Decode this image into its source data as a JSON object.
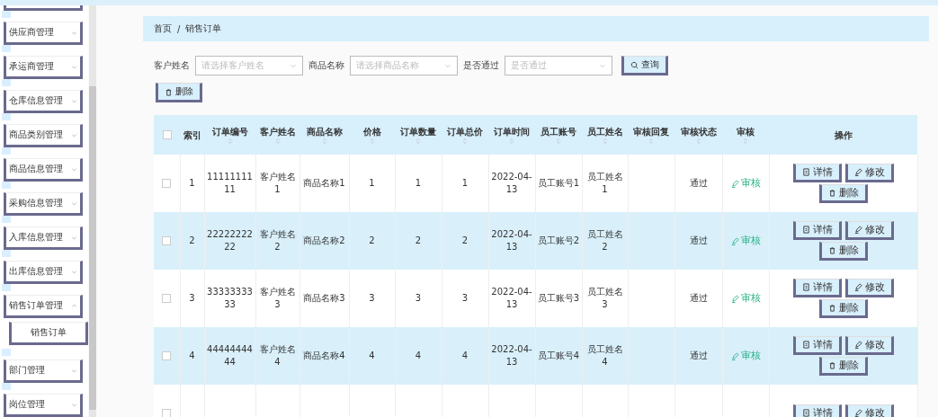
{
  "sidebar": {
    "items": [
      {
        "kind": "stub"
      },
      {
        "label": "供应商管理",
        "kind": "group",
        "expanded": false
      },
      {
        "label": "承运商管理",
        "kind": "group",
        "expanded": false
      },
      {
        "label": "仓库信息管理",
        "kind": "group",
        "expanded": false
      },
      {
        "label": "商品类别管理",
        "kind": "group",
        "expanded": false
      },
      {
        "label": "商品信息管理",
        "kind": "group",
        "expanded": false
      },
      {
        "label": "采购信息管理",
        "kind": "group",
        "expanded": false
      },
      {
        "label": "入库信息管理",
        "kind": "group",
        "expanded": false
      },
      {
        "label": "出库信息管理",
        "kind": "group",
        "expanded": false
      },
      {
        "label": "销售订单管理",
        "kind": "group",
        "expanded": true,
        "children": [
          {
            "label": "销售订单",
            "kind": "leaf"
          }
        ]
      },
      {
        "label": "部门管理",
        "kind": "group",
        "expanded": false
      },
      {
        "label": "岗位管理",
        "kind": "group",
        "expanded": false
      }
    ]
  },
  "breadcrumb": [
    "首页",
    "/",
    "销售订单"
  ],
  "filters": [
    {
      "label": "客户姓名",
      "placeholder": "请选择客户姓名"
    },
    {
      "label": "商品名称",
      "placeholder": "请选择商品名称"
    },
    {
      "label": "是否通过",
      "placeholder": "是否通过"
    }
  ],
  "search_button": "查询",
  "delete_button": "删除",
  "table": {
    "select_all": {
      "checked": false
    },
    "columns": [
      {
        "label": "索引",
        "sortable": false
      },
      {
        "label": "订单编号",
        "sortable": true
      },
      {
        "label": "客户姓名",
        "sortable": true
      },
      {
        "label": "商品名称",
        "sortable": true
      },
      {
        "label": "价格",
        "sortable": true
      },
      {
        "label": "订单数量",
        "sortable": true
      },
      {
        "label": "订单总价",
        "sortable": true
      },
      {
        "label": "订单时间",
        "sortable": true
      },
      {
        "label": "员工账号",
        "sortable": true
      },
      {
        "label": "员工姓名",
        "sortable": true
      },
      {
        "label": "审核回复",
        "sortable": true
      },
      {
        "label": "审核状态",
        "sortable": true
      },
      {
        "label": "审核",
        "sortable": true
      },
      {
        "label": "操作",
        "sortable": false
      }
    ],
    "rows": [
      {
        "checked": false,
        "cells": [
          "1",
          "1111111111",
          "客户姓名1",
          "商品名称1",
          "1",
          "1",
          "1",
          "2022-04-13",
          "员工账号1",
          "员工姓名1",
          "",
          "通过"
        ],
        "review": "审核",
        "actions": [
          "详情",
          "修改",
          "删除"
        ]
      },
      {
        "checked": false,
        "cells": [
          "2",
          "2222222222",
          "客户姓名2",
          "商品名称2",
          "2",
          "2",
          "2",
          "2022-04-13",
          "员工账号2",
          "员工姓名2",
          "",
          "通过"
        ],
        "review": "审核",
        "actions": [
          "详情",
          "修改",
          "删除"
        ]
      },
      {
        "checked": false,
        "cells": [
          "3",
          "3333333333",
          "客户姓名3",
          "商品名称3",
          "3",
          "3",
          "3",
          "2022-04-13",
          "员工账号3",
          "员工姓名3",
          "",
          "通过"
        ],
        "review": "审核",
        "actions": [
          "详情",
          "修改",
          "删除"
        ]
      },
      {
        "checked": false,
        "cells": [
          "4",
          "4444444444",
          "客户姓名4",
          "商品名称4",
          "4",
          "4",
          "4",
          "2022-04-13",
          "员工账号4",
          "员工姓名4",
          "",
          "通过"
        ],
        "review": "审核",
        "actions": [
          "详情",
          "修改",
          "删除"
        ]
      },
      {
        "checked": false,
        "cells": [],
        "review": "",
        "actions": [
          "详情",
          "修改"
        ]
      }
    ]
  }
}
